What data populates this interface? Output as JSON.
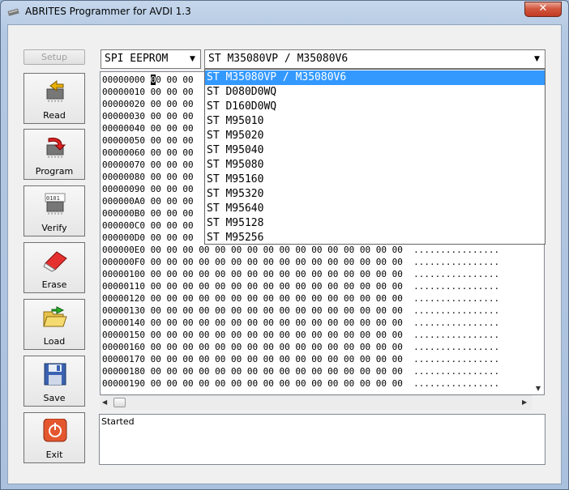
{
  "window": {
    "title": "ABRITES Programmer for AVDI 1.3",
    "close_glyph": "✕"
  },
  "sidebar": {
    "setup_label": "Setup",
    "buttons": [
      {
        "label": "Read",
        "icon": "read-chip-icon"
      },
      {
        "label": "Program",
        "icon": "program-chip-icon"
      },
      {
        "label": "Verify",
        "icon": "verify-chip-icon"
      },
      {
        "label": "Erase",
        "icon": "eraser-icon"
      },
      {
        "label": "Load",
        "icon": "folder-open-icon"
      },
      {
        "label": "Save",
        "icon": "floppy-disk-icon"
      },
      {
        "label": "Exit",
        "icon": "power-icon"
      }
    ]
  },
  "memory_type": {
    "value": "SPI EEPROM"
  },
  "chip": {
    "value": "ST M35080VP / M35080V6",
    "options": [
      "ST M35080VP / M35080V6",
      "ST D080D0WQ",
      "ST D160D0WQ",
      "ST M95010",
      "ST M95020",
      "ST M95040",
      "ST M95080",
      "ST M95160",
      "ST M95320",
      "ST M95640",
      "ST M95128",
      "ST M95256"
    ],
    "selected_index": 0
  },
  "hex_view": {
    "cursor_char": "0",
    "first_byte_rest": "0",
    "covered_byte_tail": "00 00",
    "bytes_line": "00 00 00 00 00 00 00 00 00 00 00 00 00 00 00 00",
    "ascii_line": "................",
    "addresses": [
      "00000000",
      "00000010",
      "00000020",
      "00000030",
      "00000040",
      "00000050",
      "00000060",
      "00000070",
      "00000080",
      "00000090",
      "000000A0",
      "000000B0",
      "000000C0",
      "000000D0",
      "000000E0",
      "000000F0",
      "00000100",
      "00000110",
      "00000120",
      "00000130",
      "00000140",
      "00000150",
      "00000160",
      "00000170",
      "00000180",
      "00000190"
    ]
  },
  "log": {
    "lines": [
      "Started"
    ]
  },
  "colors": {
    "selection": "#3399ff",
    "title_close": "#c13a22"
  }
}
